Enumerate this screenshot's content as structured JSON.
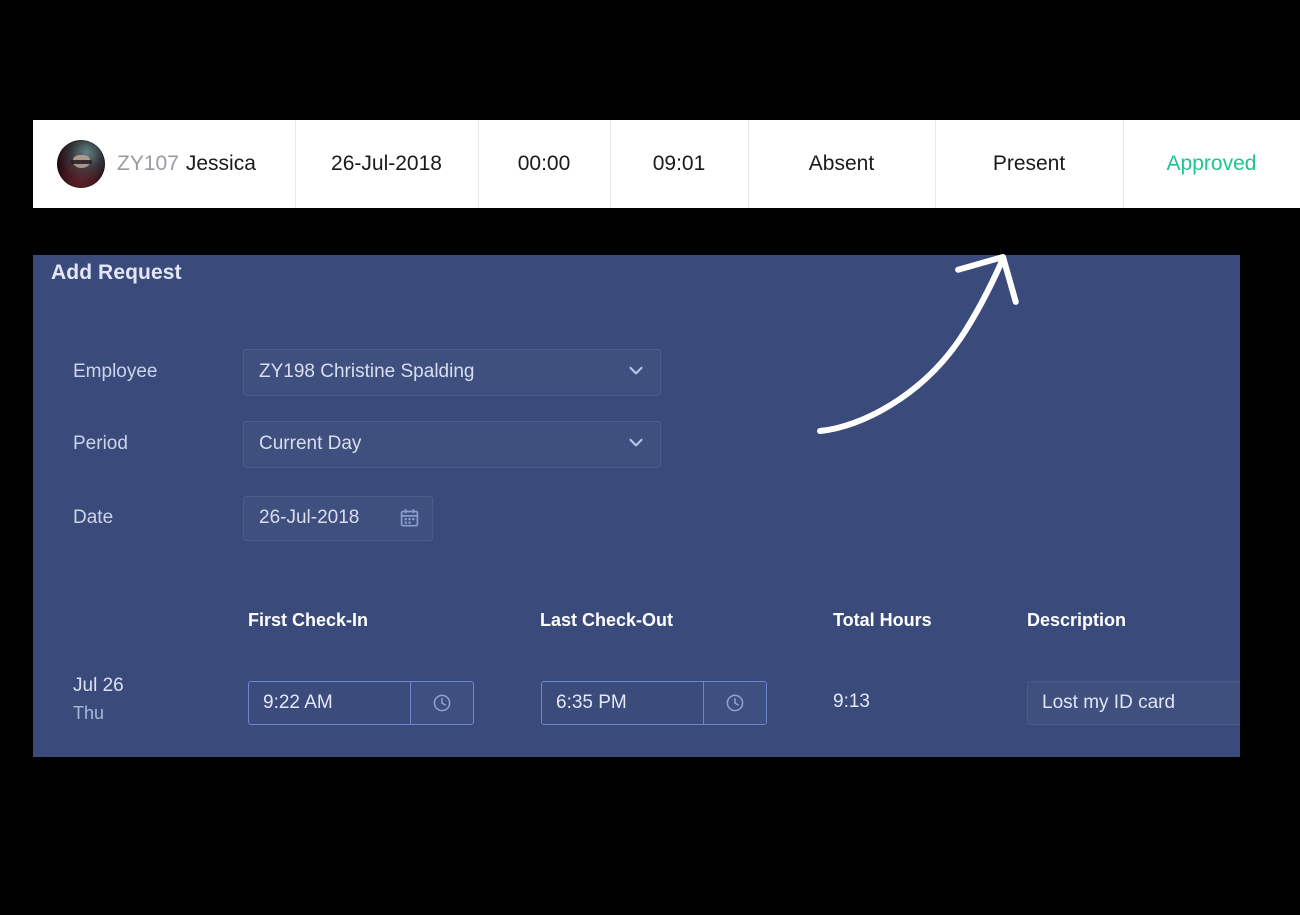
{
  "attendance_row": {
    "employee": {
      "avatar": "user-avatar-photo",
      "id": "ZY107",
      "name": "Jessica"
    },
    "date": "26-Jul-2018",
    "hours": "00:00",
    "total": "09:01",
    "status_first": "Absent",
    "status_second": "Present",
    "approval": "Approved",
    "approval_color": "#1ec48f"
  },
  "add_request": {
    "title": "Add Request",
    "panel_color": "#3a4a7a",
    "fields": {
      "employee_label": "Employee",
      "employee_value": "ZY198 Christine Spalding",
      "period_label": "Period",
      "period_value": "Current Day",
      "date_label": "Date",
      "date_value": "26-Jul-2018"
    },
    "table": {
      "headers": {
        "check_in": "First Check-In",
        "check_out": "Last Check-Out",
        "total_hours": "Total Hours",
        "description": "Description"
      },
      "row": {
        "day": "Jul 26",
        "weekday": "Thu",
        "check_in": "9:22 AM",
        "check_out": "6:35 PM",
        "total_hours": "9:13",
        "description": "Lost my ID card"
      }
    },
    "icons": {
      "employee_dropdown": "chevron-down-icon",
      "period_dropdown": "chevron-down-icon",
      "date_picker": "calendar-icon",
      "check_in_picker": "clock-icon",
      "check_out_picker": "clock-icon"
    }
  },
  "annotation": {
    "arrow": "curved-arrow-pointing-up-right",
    "color": "#ffffff"
  }
}
